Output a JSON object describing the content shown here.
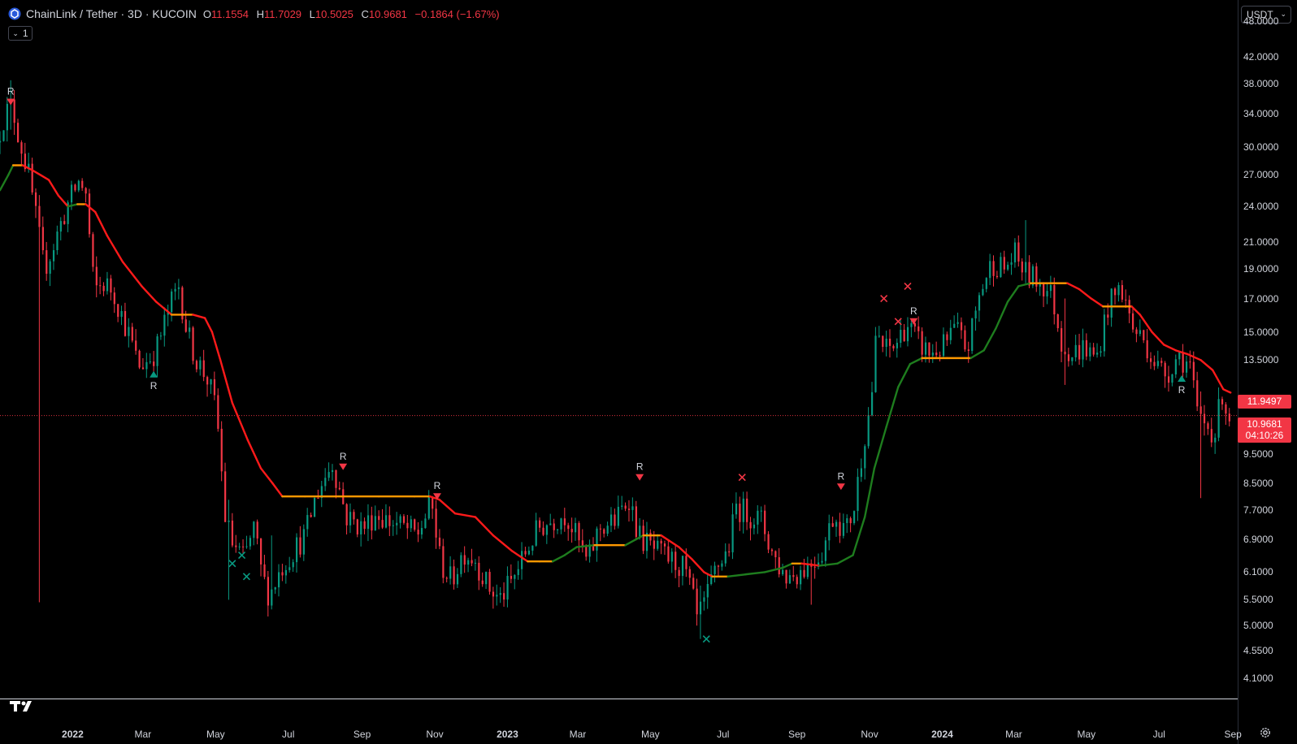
{
  "header": {
    "symbol_title": "ChainLink / Tether · 3D · KUCOIN",
    "ohlc": [
      {
        "label": "O",
        "value": "11.1554"
      },
      {
        "label": "H",
        "value": "11.7029"
      },
      {
        "label": "L",
        "value": "10.5025"
      },
      {
        "label": "C",
        "value": "10.9681"
      }
    ],
    "change": "−0.1864 (−1.67%)",
    "indicator_count": "1",
    "currency": "USDT"
  },
  "price_tags": {
    "indicator_value": "11.9497",
    "last_price": "10.9681",
    "countdown": "04:10:26"
  },
  "colors": {
    "up": "#089981",
    "down": "#f23645",
    "trend_down": "#ff1a1a",
    "trend_up": "#1e7d1e",
    "trend_flat": "#ff9800",
    "background": "#000000"
  },
  "chart_data": {
    "type": "candlestick",
    "scale": "log",
    "y_ticks": [
      "48.0000",
      "42.0000",
      "38.0000",
      "34.0000",
      "30.0000",
      "27.0000",
      "24.0000",
      "21.0000",
      "19.0000",
      "17.0000",
      "15.0000",
      "13.5000",
      "9.5000",
      "8.5000",
      "7.7000",
      "6.9000",
      "6.1000",
      "5.5000",
      "5.0000",
      "4.5500",
      "4.1000"
    ],
    "x_ticks": [
      {
        "label": "2022",
        "date": "2022-01-01",
        "bold": true
      },
      {
        "label": "Mar",
        "date": "2022-03-01",
        "bold": false
      },
      {
        "label": "May",
        "date": "2022-05-01",
        "bold": false
      },
      {
        "label": "Jul",
        "date": "2022-07-01",
        "bold": false
      },
      {
        "label": "Sep",
        "date": "2022-09-01",
        "bold": false
      },
      {
        "label": "Nov",
        "date": "2022-11-01",
        "bold": false
      },
      {
        "label": "2023",
        "date": "2023-01-01",
        "bold": true
      },
      {
        "label": "Mar",
        "date": "2023-03-01",
        "bold": false
      },
      {
        "label": "May",
        "date": "2023-05-01",
        "bold": false
      },
      {
        "label": "Jul",
        "date": "2023-07-01",
        "bold": false
      },
      {
        "label": "Sep",
        "date": "2023-09-01",
        "bold": false
      },
      {
        "label": "Nov",
        "date": "2023-11-01",
        "bold": false
      },
      {
        "label": "2024",
        "date": "2024-01-01",
        "bold": true
      },
      {
        "label": "Mar",
        "date": "2024-03-01",
        "bold": false
      },
      {
        "label": "May",
        "date": "2024-05-01",
        "bold": false
      },
      {
        "label": "Jul",
        "date": "2024-07-01",
        "bold": false
      },
      {
        "label": "Sep",
        "date": "2024-09-01",
        "bold": false
      }
    ],
    "x_start": "2021-11-01",
    "x_end": "2024-09-05",
    "y_min": 3.8,
    "y_max": 52,
    "price_path": [
      [
        "2021-11-01",
        30.5
      ],
      [
        "2021-11-08",
        34.0
      ],
      [
        "2021-11-14",
        35.0
      ],
      [
        "2021-11-20",
        31.0
      ],
      [
        "2021-11-28",
        27.0
      ],
      [
        "2021-12-05",
        22.5
      ],
      [
        "2021-12-11",
        19.0
      ],
      [
        "2021-12-18",
        20.5
      ],
      [
        "2021-12-25",
        22.5
      ],
      [
        "2022-01-01",
        24.5
      ],
      [
        "2022-01-10",
        26.5
      ],
      [
        "2022-01-15",
        25.0
      ],
      [
        "2022-01-22",
        17.5
      ],
      [
        "2022-01-30",
        18.0
      ],
      [
        "2022-02-07",
        17.5
      ],
      [
        "2022-02-14",
        16.0
      ],
      [
        "2022-02-22",
        14.5
      ],
      [
        "2022-02-28",
        13.2
      ],
      [
        "2022-03-08",
        13.5
      ],
      [
        "2022-03-15",
        14.0
      ],
      [
        "2022-03-22",
        15.5
      ],
      [
        "2022-03-29",
        17.0
      ],
      [
        "2022-04-03",
        17.8
      ],
      [
        "2022-04-10",
        15.0
      ],
      [
        "2022-04-18",
        13.5
      ],
      [
        "2022-04-28",
        12.5
      ],
      [
        "2022-05-05",
        11.0
      ],
      [
        "2022-05-12",
        7.5
      ],
      [
        "2022-05-18",
        6.8
      ],
      [
        "2022-05-28",
        6.4
      ],
      [
        "2022-06-05",
        7.2
      ],
      [
        "2022-06-12",
        6.0
      ],
      [
        "2022-06-18",
        5.6
      ],
      [
        "2022-06-28",
        6.2
      ],
      [
        "2022-07-08",
        6.6
      ],
      [
        "2022-07-18",
        7.0
      ],
      [
        "2022-07-28",
        8.2
      ],
      [
        "2022-08-10",
        9.2
      ],
      [
        "2022-08-22",
        7.5
      ],
      [
        "2022-09-05",
        7.2
      ],
      [
        "2022-09-15",
        7.6
      ],
      [
        "2022-09-25",
        7.4
      ],
      [
        "2022-10-10",
        7.2
      ],
      [
        "2022-10-20",
        7.0
      ],
      [
        "2022-11-01",
        7.9
      ],
      [
        "2022-11-09",
        6.3
      ],
      [
        "2022-11-18",
        5.9
      ],
      [
        "2022-11-28",
        6.6
      ],
      [
        "2022-12-08",
        6.4
      ],
      [
        "2022-12-18",
        5.8
      ],
      [
        "2022-12-28",
        5.5
      ],
      [
        "2023-01-08",
        5.9
      ],
      [
        "2023-01-18",
        6.5
      ],
      [
        "2023-01-30",
        7.2
      ],
      [
        "2023-02-10",
        7.4
      ],
      [
        "2023-02-22",
        7.6
      ],
      [
        "2023-03-05",
        6.8
      ],
      [
        "2023-03-12",
        6.3
      ],
      [
        "2023-03-22",
        7.2
      ],
      [
        "2023-04-05",
        7.4
      ],
      [
        "2023-04-16",
        8.1
      ],
      [
        "2023-04-24",
        7.0
      ],
      [
        "2023-05-08",
        6.6
      ],
      [
        "2023-05-20",
        6.4
      ],
      [
        "2023-06-01",
        6.2
      ],
      [
        "2023-06-08",
        5.6
      ],
      [
        "2023-06-12",
        5.1
      ],
      [
        "2023-06-20",
        5.5
      ],
      [
        "2023-06-28",
        6.2
      ],
      [
        "2023-07-08",
        6.6
      ],
      [
        "2023-07-15",
        7.8
      ],
      [
        "2023-07-25",
        7.6
      ],
      [
        "2023-08-05",
        7.4
      ],
      [
        "2023-08-15",
        6.5
      ],
      [
        "2023-08-25",
        6.0
      ],
      [
        "2023-09-05",
        6.1
      ],
      [
        "2023-09-15",
        6.3
      ],
      [
        "2023-09-25",
        6.6
      ],
      [
        "2023-10-05",
        7.6
      ],
      [
        "2023-10-15",
        7.1
      ],
      [
        "2023-10-22",
        7.8
      ],
      [
        "2023-10-30",
        10.0
      ],
      [
        "2023-11-05",
        11.5
      ],
      [
        "2023-11-10",
        15.0
      ],
      [
        "2023-11-16",
        14.0
      ],
      [
        "2023-11-25",
        14.2
      ],
      [
        "2023-12-05",
        15.5
      ],
      [
        "2023-12-15",
        14.4
      ],
      [
        "2023-12-25",
        13.8
      ],
      [
        "2024-01-05",
        14.2
      ],
      [
        "2024-01-15",
        15.2
      ],
      [
        "2024-01-25",
        14.0
      ],
      [
        "2024-02-05",
        17.5
      ],
      [
        "2024-02-15",
        19.5
      ],
      [
        "2024-02-25",
        19.0
      ],
      [
        "2024-03-05",
        20.0
      ],
      [
        "2024-03-15",
        18.5
      ],
      [
        "2024-03-25",
        18.2
      ],
      [
        "2024-04-05",
        17.2
      ],
      [
        "2024-04-13",
        14.5
      ],
      [
        "2024-04-22",
        13.8
      ],
      [
        "2024-05-02",
        14.2
      ],
      [
        "2024-05-12",
        13.5
      ],
      [
        "2024-05-22",
        16.5
      ],
      [
        "2024-06-02",
        17.8
      ],
      [
        "2024-06-12",
        15.2
      ],
      [
        "2024-06-22",
        14.5
      ],
      [
        "2024-07-02",
        13.2
      ],
      [
        "2024-07-10",
        12.8
      ],
      [
        "2024-07-20",
        13.8
      ],
      [
        "2024-07-30",
        13.2
      ],
      [
        "2024-08-05",
        11.0
      ],
      [
        "2024-08-12",
        10.6
      ],
      [
        "2024-08-20",
        10.3
      ],
      [
        "2024-08-26",
        12.0
      ],
      [
        "2024-08-30",
        10.97
      ]
    ],
    "wick_extremes": [
      {
        "date": "2021-12-05",
        "low": 5.45,
        "high": 22.5
      },
      {
        "date": "2022-05-12",
        "low": 5.5,
        "high": 8.0
      },
      {
        "date": "2022-06-18",
        "low": 5.35,
        "high": 7.0
      },
      {
        "date": "2023-06-12",
        "low": 4.75,
        "high": 5.8
      },
      {
        "date": "2023-09-12",
        "low": 5.4,
        "high": 6.4
      },
      {
        "date": "2024-04-13",
        "low": 12.3,
        "high": 17.0
      },
      {
        "date": "2024-08-05",
        "low": 8.05,
        "high": 12.0
      },
      {
        "date": "2021-11-10",
        "low": 32.0,
        "high": 38.5
      },
      {
        "date": "2024-03-12",
        "low": 18.0,
        "high": 22.8
      }
    ],
    "trend_line": [
      [
        "2021-11-01",
        25.5
      ],
      [
        "2021-11-08",
        27.0
      ],
      [
        "2021-11-12",
        28.0
      ],
      [
        "2021-11-20",
        28.0
      ],
      [
        "2021-11-28",
        27.5
      ],
      [
        "2021-12-05",
        27.0
      ],
      [
        "2021-12-12",
        26.5
      ],
      [
        "2021-12-20",
        25.0
      ],
      [
        "2021-12-28",
        24.0
      ],
      [
        "2022-01-05",
        24.2
      ],
      [
        "2022-01-12",
        24.2
      ],
      [
        "2022-01-20",
        23.5
      ],
      [
        "2022-01-30",
        21.5
      ],
      [
        "2022-02-12",
        19.5
      ],
      [
        "2022-02-28",
        17.8
      ],
      [
        "2022-03-12",
        16.8
      ],
      [
        "2022-03-25",
        16.0
      ],
      [
        "2022-04-12",
        16.0
      ],
      [
        "2022-04-22",
        15.8
      ],
      [
        "2022-04-28",
        15.0
      ],
      [
        "2022-05-05",
        13.5
      ],
      [
        "2022-05-15",
        11.5
      ],
      [
        "2022-05-28",
        10.0
      ],
      [
        "2022-06-08",
        9.0
      ],
      [
        "2022-06-18",
        8.5
      ],
      [
        "2022-06-26",
        8.1
      ],
      [
        "2022-07-15",
        8.1
      ],
      [
        "2022-08-15",
        8.1
      ],
      [
        "2022-09-15",
        8.1
      ],
      [
        "2022-10-15",
        8.1
      ],
      [
        "2022-10-28",
        8.1
      ],
      [
        "2022-11-05",
        8.0
      ],
      [
        "2022-11-18",
        7.6
      ],
      [
        "2022-12-05",
        7.5
      ],
      [
        "2022-12-20",
        7.0
      ],
      [
        "2023-01-05",
        6.6
      ],
      [
        "2023-01-18",
        6.35
      ],
      [
        "2023-01-28",
        6.35
      ],
      [
        "2023-02-08",
        6.35
      ],
      [
        "2023-02-18",
        6.5
      ],
      [
        "2023-02-28",
        6.7
      ],
      [
        "2023-03-15",
        6.75
      ],
      [
        "2023-04-10",
        6.75
      ],
      [
        "2023-04-25",
        7.0
      ],
      [
        "2023-05-10",
        7.0
      ],
      [
        "2023-05-25",
        6.7
      ],
      [
        "2023-06-05",
        6.4
      ],
      [
        "2023-06-15",
        6.1
      ],
      [
        "2023-06-22",
        6.0
      ],
      [
        "2023-07-05",
        6.0
      ],
      [
        "2023-07-20",
        6.05
      ],
      [
        "2023-08-05",
        6.1
      ],
      [
        "2023-08-20",
        6.2
      ],
      [
        "2023-08-28",
        6.3
      ],
      [
        "2023-09-05",
        6.3
      ],
      [
        "2023-09-20",
        6.25
      ],
      [
        "2023-10-05",
        6.3
      ],
      [
        "2023-10-18",
        6.5
      ],
      [
        "2023-10-28",
        7.5
      ],
      [
        "2023-11-05",
        9.0
      ],
      [
        "2023-11-15",
        10.5
      ],
      [
        "2023-11-25",
        12.2
      ],
      [
        "2023-12-05",
        13.3
      ],
      [
        "2023-12-15",
        13.6
      ],
      [
        "2024-01-05",
        13.6
      ],
      [
        "2024-01-25",
        13.6
      ],
      [
        "2024-02-05",
        14.0
      ],
      [
        "2024-02-15",
        15.2
      ],
      [
        "2024-02-25",
        16.8
      ],
      [
        "2024-03-05",
        17.8
      ],
      [
        "2024-03-15",
        18.0
      ],
      [
        "2024-04-05",
        18.0
      ],
      [
        "2024-04-15",
        18.0
      ],
      [
        "2024-04-25",
        17.6
      ],
      [
        "2024-05-05",
        17.0
      ],
      [
        "2024-05-15",
        16.5
      ],
      [
        "2024-05-25",
        16.5
      ],
      [
        "2024-06-08",
        16.5
      ],
      [
        "2024-06-15",
        16.0
      ],
      [
        "2024-06-25",
        15.0
      ],
      [
        "2024-07-05",
        14.3
      ],
      [
        "2024-07-15",
        14.0
      ],
      [
        "2024-07-25",
        13.8
      ],
      [
        "2024-08-05",
        13.5
      ],
      [
        "2024-08-15",
        13.0
      ],
      [
        "2024-08-24",
        12.1
      ],
      [
        "2024-08-30",
        11.95
      ]
    ],
    "signals": [
      {
        "type": "down",
        "date": "2021-11-10",
        "price": 35.5,
        "label": "R",
        "label_pos": "above"
      },
      {
        "type": "up",
        "date": "2022-03-10",
        "price": 12.8,
        "label": "R",
        "label_pos": "below"
      },
      {
        "type": "down",
        "date": "2022-08-16",
        "price": 9.05,
        "label": "R",
        "label_pos": "above"
      },
      {
        "type": "down",
        "date": "2022-11-03",
        "price": 8.1,
        "label": "R",
        "label_pos": "above"
      },
      {
        "type": "down",
        "date": "2023-04-22",
        "price": 8.7,
        "label": "R",
        "label_pos": "above"
      },
      {
        "type": "down",
        "date": "2023-10-08",
        "price": 8.4,
        "label": "R",
        "label_pos": "above"
      },
      {
        "type": "down",
        "date": "2023-12-08",
        "price": 15.6,
        "label": "R",
        "label_pos": "above"
      },
      {
        "type": "up",
        "date": "2024-07-20",
        "price": 12.6,
        "label": "R",
        "label_pos": "below"
      },
      {
        "type": "xg",
        "date": "2022-05-15",
        "price": 6.3,
        "label": "",
        "label_pos": ""
      },
      {
        "type": "xg",
        "date": "2022-05-23",
        "price": 6.5,
        "label": "",
        "label_pos": ""
      },
      {
        "type": "xg",
        "date": "2022-05-27",
        "price": 6.0,
        "label": "",
        "label_pos": ""
      },
      {
        "type": "xg",
        "date": "2023-06-17",
        "price": 4.75,
        "label": "",
        "label_pos": ""
      },
      {
        "type": "xr",
        "date": "2023-07-17",
        "price": 8.7,
        "label": "",
        "label_pos": ""
      },
      {
        "type": "xr",
        "date": "2023-11-13",
        "price": 17.0,
        "label": "",
        "label_pos": ""
      },
      {
        "type": "xr",
        "date": "2023-11-25",
        "price": 15.6,
        "label": "",
        "label_pos": ""
      },
      {
        "type": "xr",
        "date": "2023-12-03",
        "price": 17.8,
        "label": "",
        "label_pos": ""
      }
    ]
  }
}
